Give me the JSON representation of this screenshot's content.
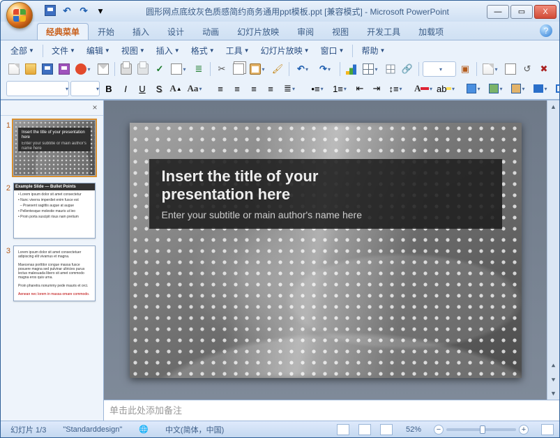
{
  "window": {
    "doc_title": "圆形网点底纹灰色质感简约商务通用ppt模板.ppt [兼容模式] - Microsoft PowerPoint"
  },
  "qat": {
    "save": "保存",
    "undo": "↶",
    "redo": "↷",
    "more": "▾"
  },
  "ribbon_tabs": {
    "items": [
      "经典菜单",
      "开始",
      "插入",
      "设计",
      "动画",
      "幻灯片放映",
      "审阅",
      "视图",
      "开发工具",
      "加载项"
    ],
    "active_index": 0
  },
  "classic_menu": {
    "items": [
      "全部",
      "文件",
      "编辑",
      "视图",
      "插入",
      "格式",
      "工具",
      "幻灯片放映",
      "窗口",
      "帮助"
    ]
  },
  "slide": {
    "title_line1": "Insert the title of your",
    "title_line2": "presentation here",
    "subtitle": "Enter your subtitle or main author's name here"
  },
  "thumbs": {
    "t1": {
      "title": "Insert the title of your presentation here",
      "sub": "Enter your subtitle or main author's name here"
    },
    "t2": {
      "title": "Example Slide — Bullet Points"
    }
  },
  "notes_placeholder": "单击此处添加备注",
  "status": {
    "slide": "幻灯片 1/3",
    "theme": "\"Standarddesign\"",
    "lang": "中文(简体，中国)",
    "zoom": "52%"
  }
}
